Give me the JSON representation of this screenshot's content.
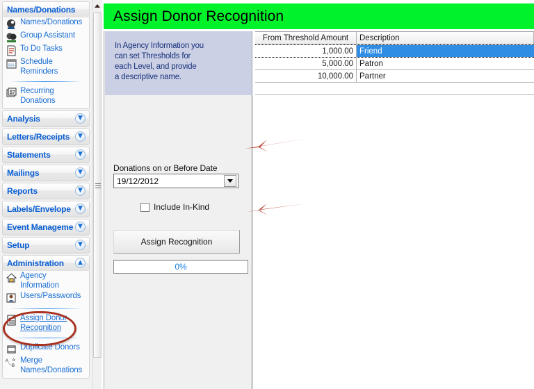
{
  "window": {
    "title": "Assign Donor Recognition",
    "title_bg": "#00f32a"
  },
  "sidebar": {
    "header": "Names/Donations",
    "scrollbar": {
      "up_icon": "triangle-up-icon"
    },
    "groups": [
      {
        "title": "Names/Donations",
        "expanded": true,
        "chevron": "chevron-up-icon",
        "items": [
          {
            "label": "Names/Donations",
            "icon": "person-head-icon"
          },
          {
            "label": "Group Assistant",
            "icon": "group-people-icon"
          },
          {
            "label": "To Do Tasks",
            "icon": "task-list-icon"
          },
          {
            "label": "Schedule\nReminders",
            "icon": "calendar-icon"
          },
          {
            "divider": true
          },
          {
            "label": "Recurring\nDonations",
            "icon": "recurring-money-icon"
          }
        ]
      },
      {
        "title": "Analysis",
        "expanded": false,
        "chevron": "chevron-down-icon",
        "items": []
      },
      {
        "title": "Letters/Receipts",
        "expanded": false,
        "chevron": "chevron-down-icon",
        "items": []
      },
      {
        "title": "Statements",
        "expanded": false,
        "chevron": "chevron-down-icon",
        "items": []
      },
      {
        "title": "Mailings",
        "expanded": false,
        "chevron": "chevron-down-icon",
        "items": []
      },
      {
        "title": "Reports",
        "expanded": false,
        "chevron": "chevron-down-icon",
        "items": []
      },
      {
        "title": "Labels/Envelope",
        "expanded": false,
        "chevron": "chevron-down-icon",
        "items": []
      },
      {
        "title": "Event Manageme",
        "expanded": false,
        "chevron": "chevron-down-icon",
        "items": []
      },
      {
        "title": "Setup",
        "expanded": false,
        "chevron": "chevron-down-icon",
        "items": []
      },
      {
        "title": "Administration",
        "expanded": true,
        "chevron": "chevron-up-icon",
        "items": [
          {
            "label": "Agency Information",
            "icon": "house-icon"
          },
          {
            "label": "Users/Passwords",
            "icon": "user-badge-icon"
          },
          {
            "divider": true
          },
          {
            "label": "Assign Donor\nRecognition",
            "icon": "checklist-document-icon",
            "selected": true,
            "underlined": true
          },
          {
            "divider": true
          },
          {
            "label": "Duplicate Donors",
            "icon": "duplicate-icon"
          },
          {
            "label": "Merge\nNames/Donations",
            "icon": "merge-icon"
          }
        ]
      }
    ]
  },
  "info_panel": {
    "text": "In Agency Information you\ncan set Thresholds for\neach Level, and provide\na descriptive name."
  },
  "form": {
    "date_label": "Donations on or Before Date",
    "date_value": "19/12/2012",
    "date_dropdown_icon": "chevron-down-icon",
    "checkbox_label": "Include In-Kind",
    "checkbox_checked": false,
    "assign_button": "Assign Recognition",
    "progress_text": "0%",
    "progress_value": 0
  },
  "grid": {
    "columns": [
      "From Threshold Amount",
      "Description"
    ],
    "rows": [
      {
        "amount": "1,000.00",
        "description": "Friend",
        "selected": true
      },
      {
        "amount": "5,000.00",
        "description": "Patron",
        "selected": false
      },
      {
        "amount": "10,000.00",
        "description": "Partner",
        "selected": false
      }
    ],
    "selection_color": "#2f8de3"
  },
  "annotations": {
    "color": "#b03a26",
    "arrows": [
      {
        "name": "arrow-pointing-date-field"
      },
      {
        "name": "arrow-pointing-assign-button"
      }
    ],
    "ellipse": {
      "name": "ellipse-around-assign-donor-recognition"
    }
  }
}
